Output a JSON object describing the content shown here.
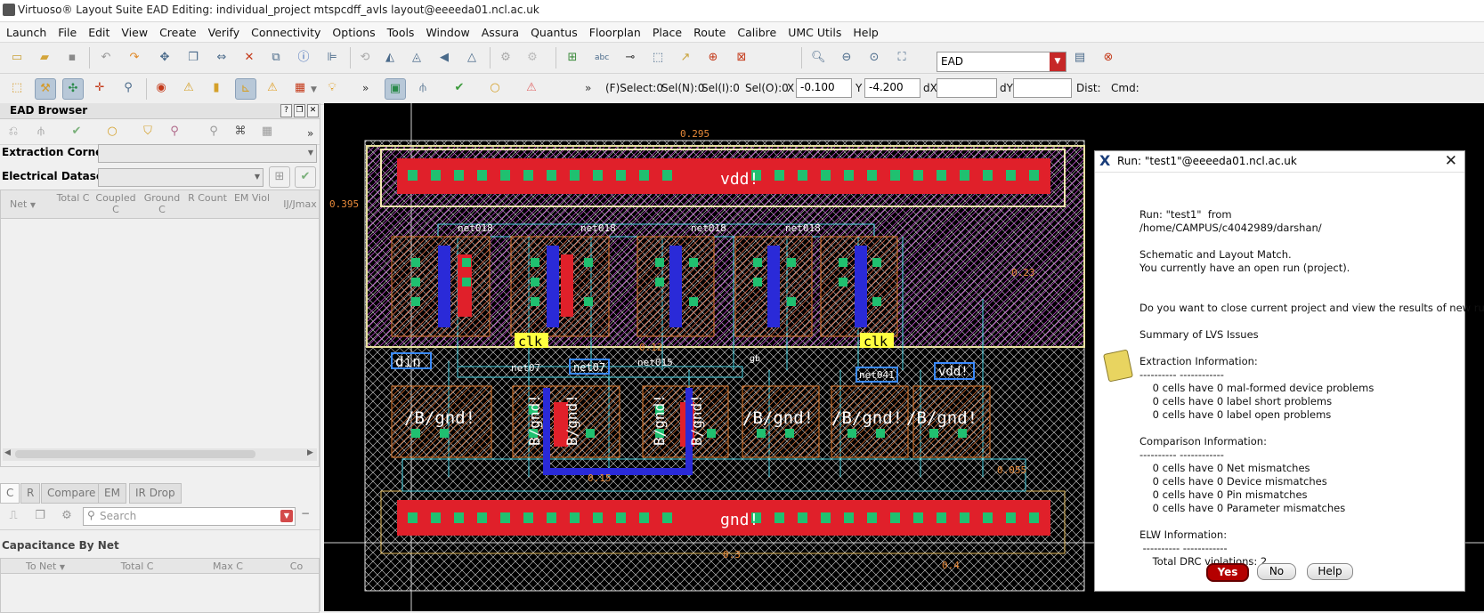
{
  "window": {
    "title": "Virtuoso® Layout Suite EAD Editing: individual_project mtspcdff_avls layout@eeeeda01.ncl.ac.uk"
  },
  "menu": [
    "Launch",
    "File",
    "Edit",
    "View",
    "Create",
    "Verify",
    "Connectivity",
    "Options",
    "Tools",
    "Window",
    "Assura",
    "Quantus",
    "Floorplan",
    "Place",
    "Route",
    "Calibre",
    "UMC Utils",
    "Help"
  ],
  "toolbar": {
    "ead_mode": "EAD"
  },
  "status": {
    "fselect": "(F)Select:0",
    "seln": "Sel(N):0",
    "seli": "Sel(I):0",
    "selo": "Sel(O):0",
    "x_label": "X",
    "x_value": "-0.100",
    "y_label": "Y",
    "y_value": "-4.200",
    "dx_label": "dX",
    "dx_value": "",
    "dy_label": "dY",
    "dy_value": "",
    "dist_label": "Dist:",
    "cmd_label": "Cmd:"
  },
  "ead_browser": {
    "title": "EAD Browser",
    "extraction_corner_label": "Extraction Corner:",
    "electrical_dataset_label": "Electrical Dataset:",
    "net_table_headers": [
      "Net",
      "Total C",
      "Coupled C",
      "Ground C",
      "R Count",
      "EM Viol",
      "IJ/Jmax"
    ],
    "tabs": [
      "C",
      "R",
      "Compare",
      "EM",
      "IR Drop"
    ],
    "search_placeholder": "Search",
    "section_title": "Capacitance By Net",
    "cap_table_headers": [
      "To Net",
      "Total C",
      "Max C",
      "Co"
    ]
  },
  "layout_labels": {
    "top_dim": "0.295",
    "left_dim": "0.395",
    "right_dim1": "0.23",
    "right_dim2": "0.055",
    "bottom_dim1": "0.3",
    "bottom_dim2": "0.4",
    "mid_dim1": "0.12",
    "mid_dim2": "0.15",
    "vdd": "vdd!",
    "gnd": "gnd!",
    "nets": [
      "net018",
      "net018",
      "net018",
      "net018"
    ],
    "pins": [
      "din",
      "clk",
      "clk",
      "net07",
      "net07",
      "net015",
      "net041",
      "vdd!",
      "gb"
    ],
    "bgnd": [
      "/B/gnd!",
      "B/gnd!",
      "B/gnd!",
      "B/gnd!",
      "B/gnd!",
      "/B/gnd!",
      "/B/gnd!",
      "/B/gnd!"
    ]
  },
  "dialog": {
    "title": "Run: \"test1\"@eeeeda01.ncl.ac.uk",
    "lines": [
      "Run: \"test1\"  from",
      "/home/CAMPUS/c4042989/darshan/",
      "",
      "Schematic and Layout Match.",
      "You currently have an open run (project).",
      "",
      "",
      "Do you want to close current project and view the results of new run?",
      "",
      "Summary of LVS Issues",
      "",
      "Extraction Information:",
      "---------- ------------",
      "    0 cells have 0 mal-formed device problems",
      "    0 cells have 0 label short problems",
      "    0 cells have 0 label open problems",
      "",
      "Comparison Information:",
      "---------- ------------",
      "    0 cells have 0 Net mismatches",
      "    0 cells have 0 Device mismatches",
      "    0 cells have 0 Pin mismatches",
      "    0 cells have 0 Parameter mismatches",
      "",
      "ELW Information:",
      " ---------- ------------",
      "    Total DRC violations: 2"
    ],
    "yes": "Yes",
    "no": "No",
    "help": "Help"
  },
  "colors": {
    "accent_red": "#b40000",
    "canvas_bg": "#000000",
    "layout_orange": "#e07a2c"
  }
}
